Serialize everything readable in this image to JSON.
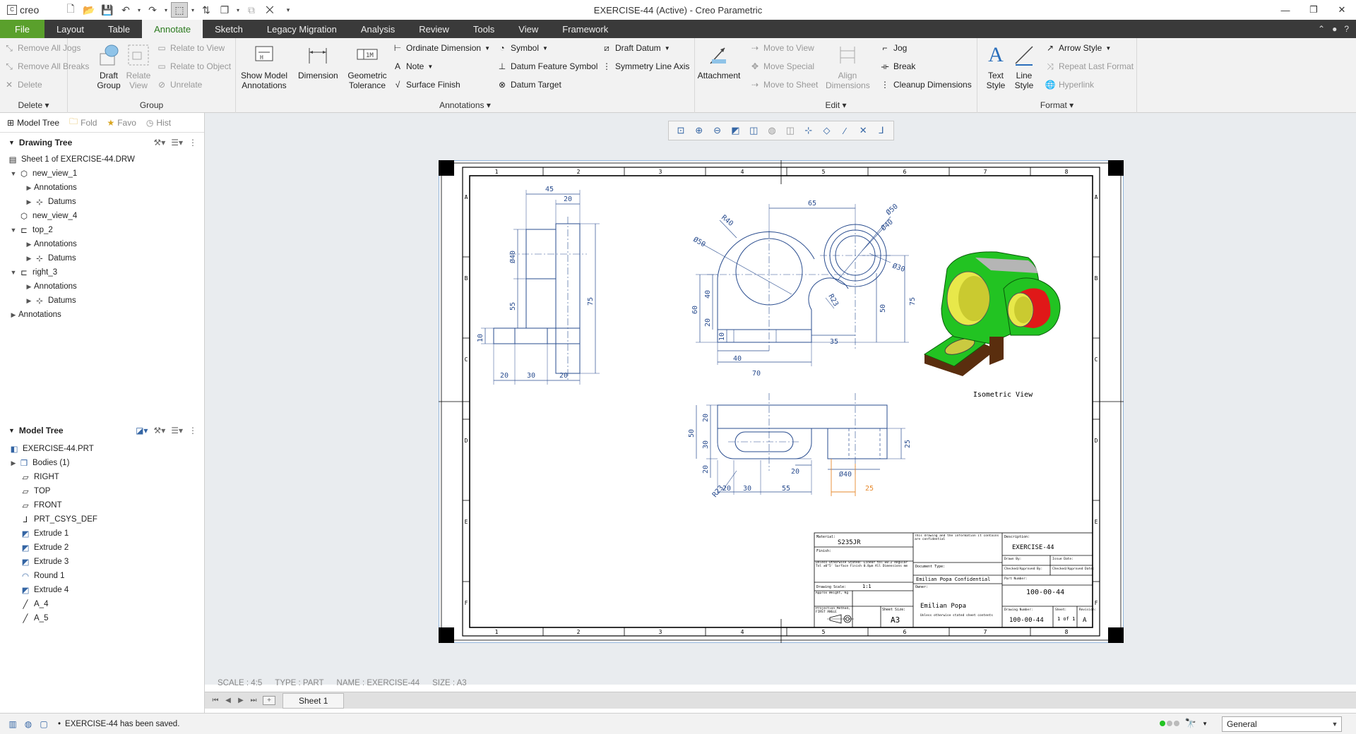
{
  "app": {
    "logo_text": "creo",
    "window_title": "EXERCISE-44 (Active) - Creo Parametric"
  },
  "tabs": [
    "File",
    "Layout",
    "Table",
    "Annotate",
    "Sketch",
    "Legacy Migration",
    "Analysis",
    "Review",
    "Tools",
    "View",
    "Framework"
  ],
  "active_tab": "Annotate",
  "ribbon": {
    "delete_group": {
      "label": "Delete ▾",
      "items": [
        "Remove All Jogs",
        "Remove All Breaks",
        "Delete"
      ]
    },
    "group_group": {
      "label": "Group",
      "draft_group": "Draft Group",
      "relate_view": "Relate View",
      "relate_to_view": "Relate to View",
      "relate_to_object": "Relate to Object",
      "unrelate": "Unrelate"
    },
    "annotations_group": {
      "label": "Annotations ▾",
      "show_model": "Show Model Annotations",
      "dimension": "Dimension",
      "geom_tol": "Geometric Tolerance",
      "ordinate": "Ordinate Dimension",
      "note": "Note",
      "surface_finish": "Surface Finish",
      "symbol": "Symbol",
      "datum_feature": "Datum Feature Symbol",
      "datum_target": "Datum Target",
      "draft_datum": "Draft Datum",
      "symmetry": "Symmetry Line Axis"
    },
    "edit_group": {
      "label": "Edit ▾",
      "attachment": "Attachment",
      "move_to_view": "Move to View",
      "move_special": "Move Special",
      "move_to_sheet": "Move to Sheet",
      "align": "Align Dimensions",
      "jog": "Jog",
      "break": "Break",
      "cleanup": "Cleanup Dimensions"
    },
    "format_group": {
      "label": "Format ▾",
      "text_style": "Text Style",
      "line_style": "Line Style",
      "arrow_style": "Arrow Style",
      "repeat_last": "Repeat Last Format",
      "hyperlink": "Hyperlink"
    }
  },
  "nav_tabs": [
    "Model Tree",
    "Fold",
    "Favo",
    "Hist"
  ],
  "drawing_tree": {
    "header": "Drawing Tree",
    "items": [
      "Sheet 1 of EXERCISE-44.DRW",
      "new_view_1",
      "Annotations",
      "Datums",
      "new_view_4",
      "top_2",
      "Annotations",
      "Datums",
      "right_3",
      "Annotations",
      "Datums",
      "Annotations"
    ]
  },
  "model_tree": {
    "header": "Model Tree",
    "items": [
      "EXERCISE-44.PRT",
      "Bodies (1)",
      "RIGHT",
      "TOP",
      "FRONT",
      "PRT_CSYS_DEF",
      "Extrude 1",
      "Extrude 2",
      "Extrude 3",
      "Round 1",
      "Extrude 4",
      "A_4",
      "A_5"
    ]
  },
  "drawing": {
    "zone_numbers": [
      "1",
      "2",
      "3",
      "4",
      "5",
      "6",
      "7",
      "8"
    ],
    "zone_letters": [
      "A",
      "B",
      "C",
      "D",
      "E",
      "F"
    ],
    "side_view_dims": [
      "45",
      "20",
      "Ø40",
      "55",
      "75",
      "10",
      "20",
      "30",
      "20"
    ],
    "front_view_dims": [
      "R40",
      "65",
      "Ø50",
      "Ø50",
      "Ø40",
      "Ø30",
      "R23",
      "60",
      "40",
      "20",
      "10",
      "75",
      "50",
      "35",
      "40",
      "70"
    ],
    "top_view_dims": [
      "20",
      "30",
      "50",
      "20",
      "25",
      "Ø40",
      "R23",
      "20",
      "20",
      "30",
      "55",
      "25"
    ],
    "iso_label": "Isometric View",
    "title_block": {
      "material_label": "Material:",
      "material": "S235JR",
      "finish_label": "Finish:",
      "tolerance_text": "Unless Otherwise Stated: Linear tol ±0.2 Angular Tol ±0°5' Surface Finish 0.8µm All Dimensions mm",
      "scale_label": "Drawing Scale:",
      "scale": "1:1",
      "weight_label": "Approx Weight, Kg",
      "projection_label": "Projection Method, FIRST ANGLE",
      "sheet_size_label": "Sheet Size:",
      "sheet_size": "A3",
      "confidential_note": "This drawing and the information it contains are confidential",
      "document_type": "Document Type:",
      "confidential": "Emilian Popa Confidential",
      "owner_label": "Owner:",
      "owner": "Emilian Popa",
      "owner_sub": "Unless otherwise stated sheet contents",
      "description_label": "Description:",
      "description": "EXERCISE-44",
      "drawn_by": "Drawn By:",
      "issue_date": "Issue Date:",
      "checked_by": "Checked/Approved By:",
      "checked_date": "Checked/Approved Date:",
      "part_number_label": "Part Number:",
      "part_number": "100-00-44",
      "drawing_number_label": "Drawing Number:",
      "drawing_number": "100-00-44",
      "sheet_label": "Sheet:",
      "sheet": "1 of 1",
      "revision_label": "Revision:",
      "revision": "A"
    }
  },
  "status_info": {
    "scale": "SCALE : 4:5",
    "type": "TYPE : PART",
    "name": "NAME : EXERCISE-44",
    "size": "SIZE : A3"
  },
  "sheet_tab": "Sheet 1",
  "status_message": "EXERCISE-44 has been saved.",
  "filter_value": "General",
  "colors": {
    "accent": "#5aa02c",
    "tabbar": "#3a3a3a",
    "dim_line": "#2a4d8f",
    "highlight": "#e68a2e",
    "iso_green": "#22c322",
    "iso_yellow": "#e8e84a",
    "iso_red": "#e01818"
  }
}
